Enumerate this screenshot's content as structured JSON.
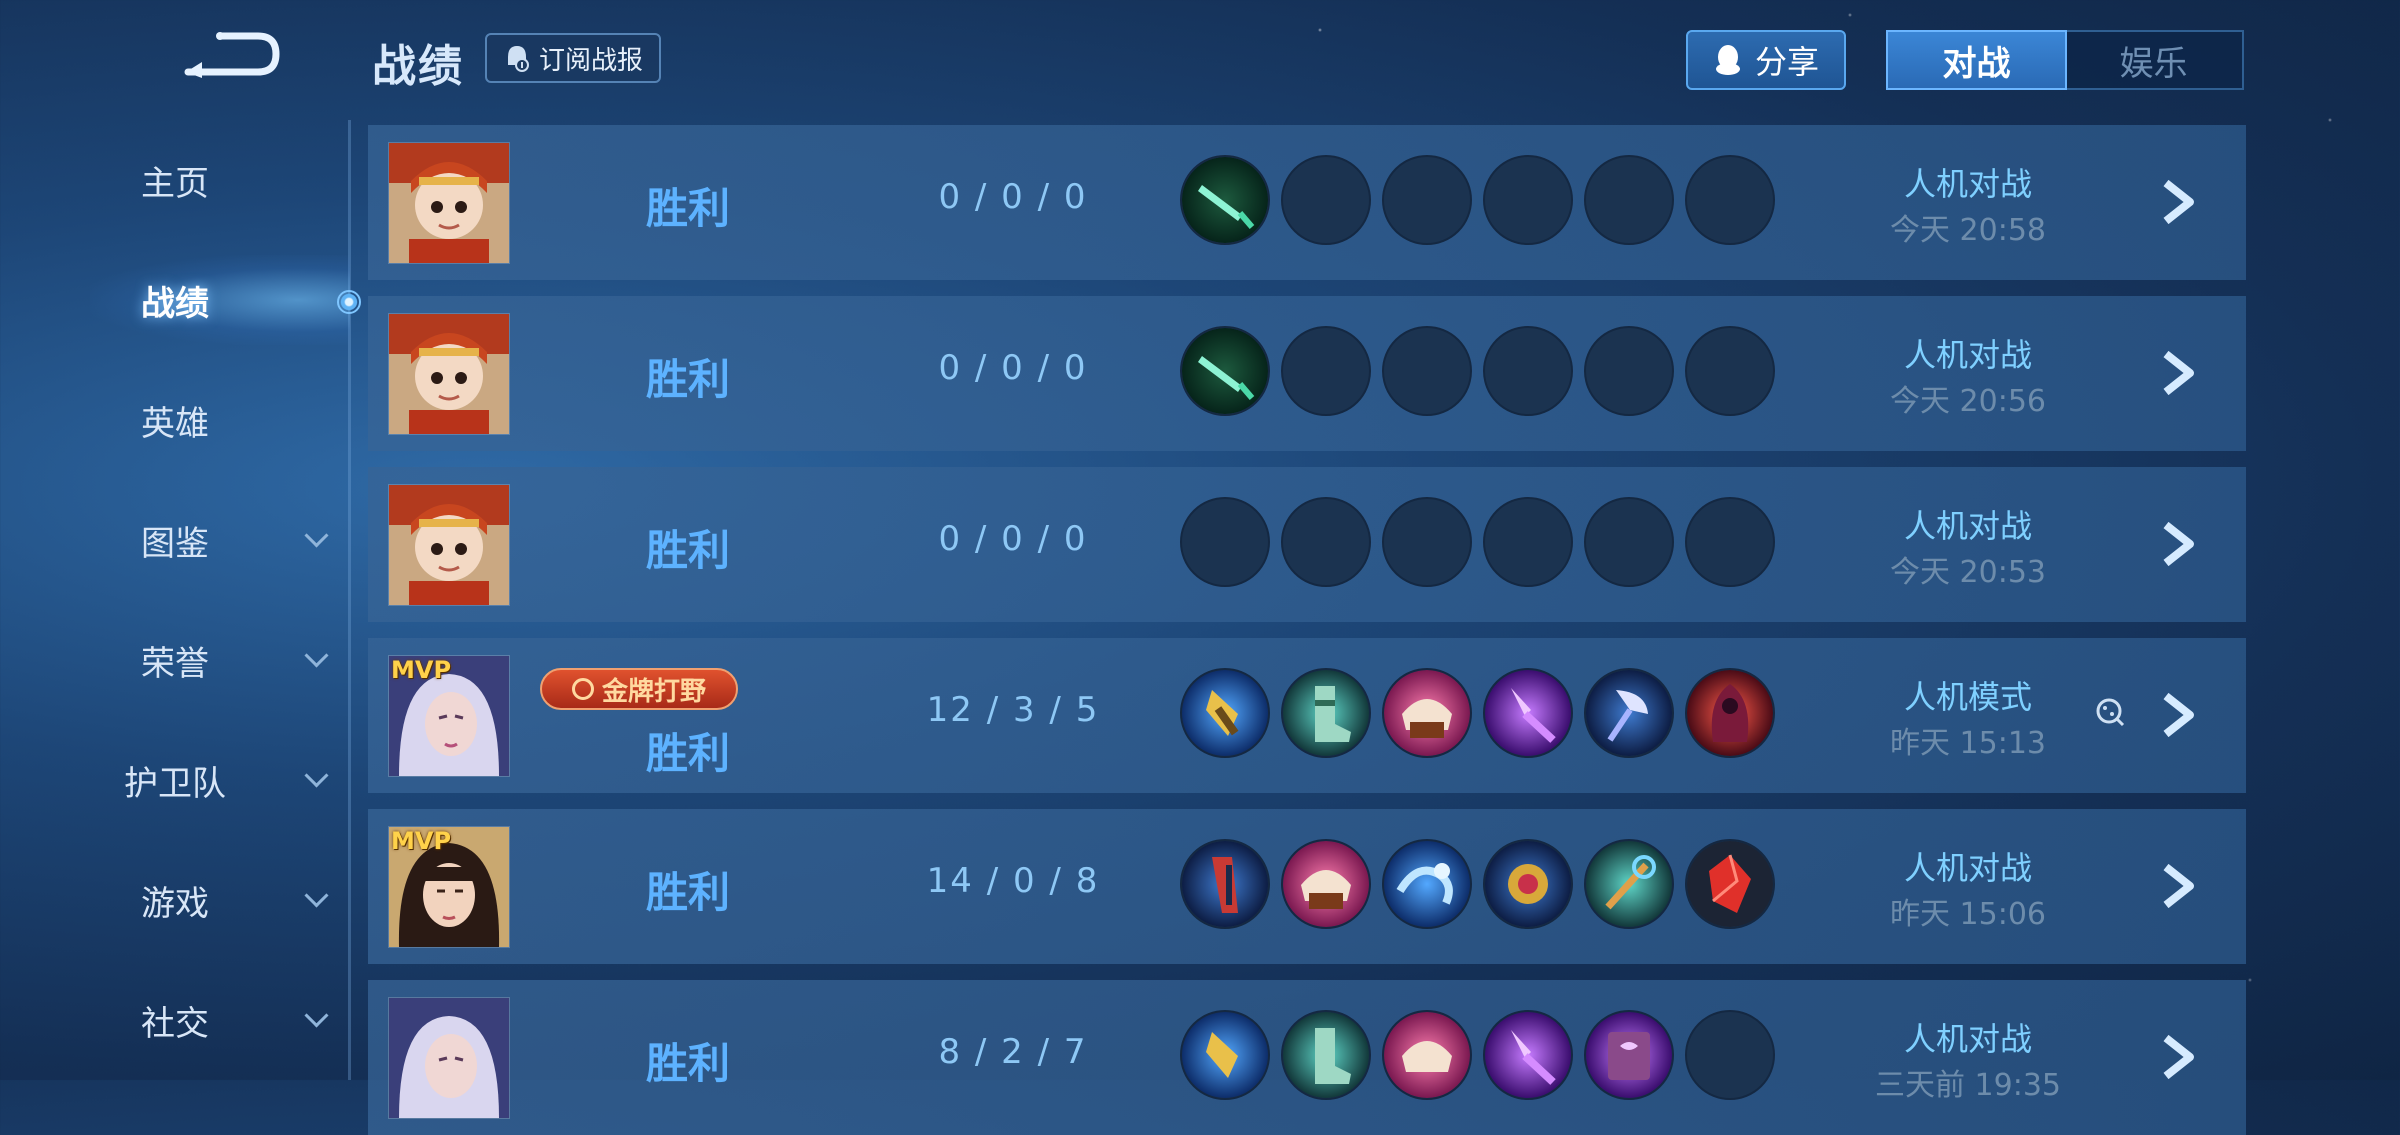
{
  "header": {
    "title": "战绩",
    "subscribe_label": "订阅战报",
    "share_label": "分享",
    "tabs": [
      {
        "label": "对战",
        "active": true
      },
      {
        "label": "娱乐",
        "active": false
      }
    ]
  },
  "sidebar": {
    "items": [
      {
        "label": "主页",
        "active": false,
        "chevron": false
      },
      {
        "label": "战绩",
        "active": true,
        "chevron": false
      },
      {
        "label": "英雄",
        "active": false,
        "chevron": false
      },
      {
        "label": "图鉴",
        "active": false,
        "chevron": true
      },
      {
        "label": "荣誉",
        "active": false,
        "chevron": true
      },
      {
        "label": "护卫队",
        "active": false,
        "chevron": true
      },
      {
        "label": "游戏",
        "active": false,
        "chevron": true
      },
      {
        "label": "社交",
        "active": false,
        "chevron": true
      }
    ]
  },
  "matches": [
    {
      "hero": "red-haired-girl",
      "mvp": false,
      "badge": "",
      "result": "胜利",
      "kda": "0 / 0 / 0",
      "mode": "人机对战",
      "time": "今天 20:58",
      "items": [
        "green-dagger",
        "",
        "",
        "",
        "",
        ""
      ]
    },
    {
      "hero": "red-haired-girl",
      "mvp": false,
      "badge": "",
      "result": "胜利",
      "kda": "0 / 0 / 0",
      "mode": "人机对战",
      "time": "今天 20:56",
      "items": [
        "green-dagger",
        "",
        "",
        "",
        "",
        ""
      ]
    },
    {
      "hero": "red-haired-girl",
      "mvp": false,
      "badge": "",
      "result": "胜利",
      "kda": "0 / 0 / 0",
      "mode": "人机对战",
      "time": "今天 20:53",
      "items": [
        "",
        "",
        "",
        "",
        "",
        ""
      ]
    },
    {
      "hero": "white-haired-woman",
      "mvp": true,
      "mvp_label": "MVP",
      "badge": "金牌打野",
      "result": "胜利",
      "kda": "12 / 3 / 5",
      "mode": "人机模式",
      "time": "昨天 15:13",
      "dice": true,
      "items": [
        "gold-blade",
        "green-boots",
        "pink-helm",
        "purple-spear",
        "blue-axe",
        "red-cloak"
      ]
    },
    {
      "hero": "dark-haired-girl",
      "mvp": true,
      "mvp_label": "MVP",
      "badge": "",
      "result": "胜利",
      "kda": "14 / 0 / 8",
      "mode": "人机对战",
      "time": "昨天 15:06",
      "items": [
        "red-sash",
        "pink-helm",
        "blue-wave",
        "gold-amulet",
        "orange-staff",
        "red-crystal"
      ]
    },
    {
      "hero": "white-haired-woman",
      "mvp": false,
      "badge": "",
      "result": "胜利",
      "kda": "8 / 2 / 7",
      "mode": "人机对战",
      "time": "三天前 19:35",
      "items": [
        "gold-blade",
        "green-boots",
        "pink-helm",
        "purple-spear",
        "purple-book",
        ""
      ]
    }
  ]
}
